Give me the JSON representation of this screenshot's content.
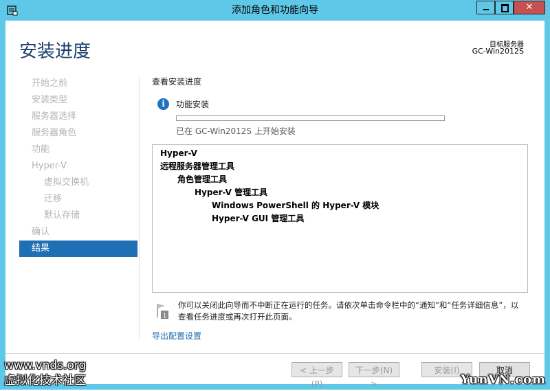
{
  "window": {
    "title": "添加角色和功能向导",
    "close_glyph": "✕",
    "accent": "#5fc8e8"
  },
  "header": {
    "page_title": "安装进度",
    "dest_label": "目标服务器",
    "dest_value": "GC-Win2012S"
  },
  "nav": {
    "items": [
      {
        "label": "开始之前"
      },
      {
        "label": "安装类型"
      },
      {
        "label": "服务器选择"
      },
      {
        "label": "服务器角色"
      },
      {
        "label": "功能"
      },
      {
        "label": "Hyper-V"
      },
      {
        "label": "虚拟交换机"
      },
      {
        "label": "迁移"
      },
      {
        "label": "默认存储"
      },
      {
        "label": "确认"
      },
      {
        "label": "结果"
      }
    ],
    "active_color": "#1f6fb5"
  },
  "content": {
    "section_label": "查看安装进度",
    "info_icon": "i",
    "feature_label": "功能安装",
    "progress": 0,
    "status_text": "已在 GC-Win2012S 上开始安装",
    "results": [
      "Hyper-V",
      "远程服务器管理工具",
      "角色管理工具",
      "Hyper-V 管理工具",
      "Windows PowerShell 的 Hyper-V 模块",
      "Hyper-V GUI 管理工具"
    ],
    "note_line1": "你可以关闭此向导而不中断正在运行的任务。请依次单击命令栏中的“通知”和“任务详细信息”，以",
    "note_line2": "查看任务进度或再次打开此页面。",
    "flag_badge": "1",
    "export_link": "导出配置设置"
  },
  "buttons": {
    "prev": "< 上一步(P)",
    "next": "下一步(N) >",
    "install": "安装(I)",
    "cancel": "取消"
  },
  "watermarks": {
    "left_line1": "www.vnds.org",
    "left_line2": "虚拟化技术社区",
    "right": "YunVN.com"
  }
}
